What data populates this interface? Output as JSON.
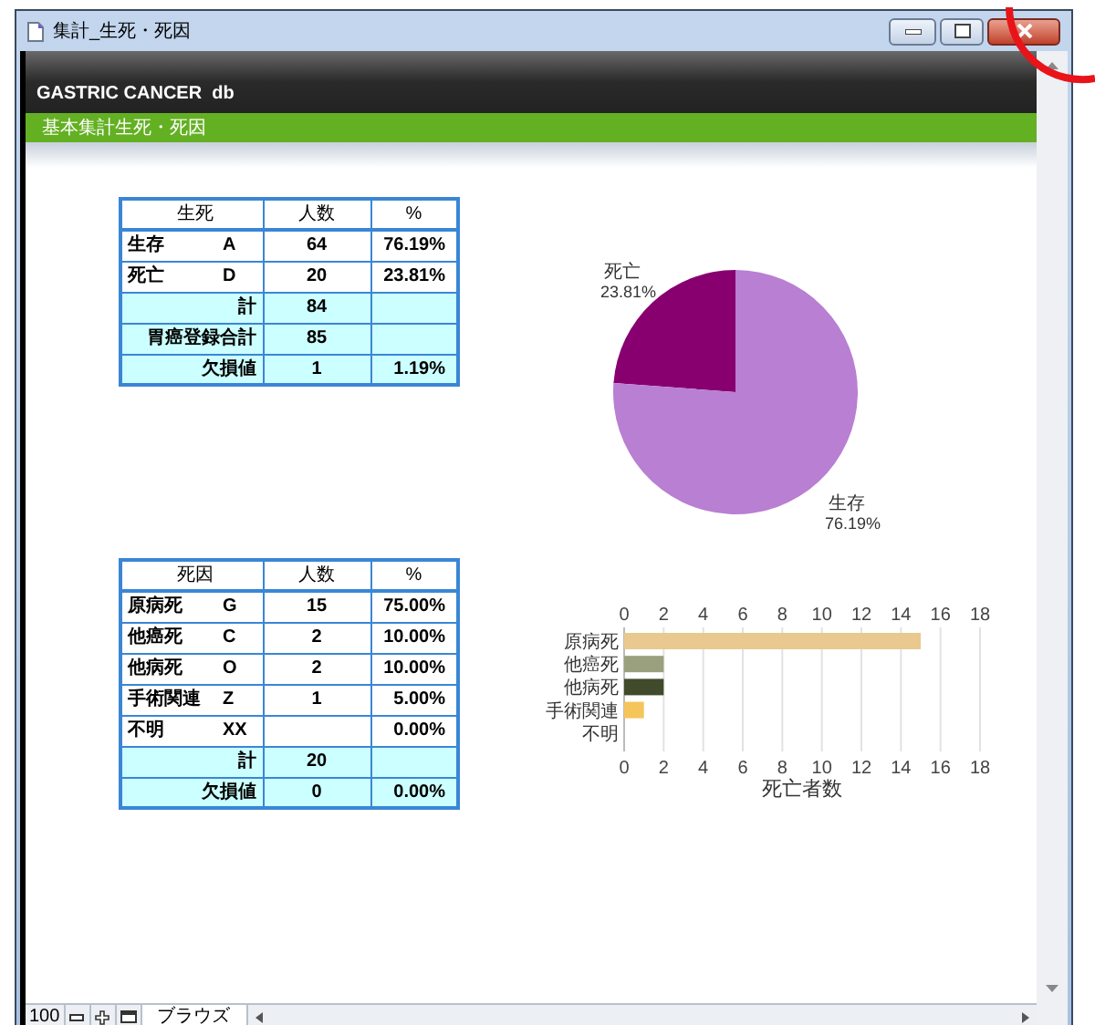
{
  "window": {
    "title": "集計_生死・死因"
  },
  "header": {
    "title": "GASTRIC CANCER  db",
    "subtitle": "基本集計生死・死因"
  },
  "survival_table": {
    "columns": [
      "生死",
      "人数",
      "%"
    ],
    "rows": [
      {
        "kind": "data",
        "label": "生存",
        "code": "A",
        "count": "64",
        "percent": "76.19%"
      },
      {
        "kind": "data",
        "label": "死亡",
        "code": "D",
        "count": "20",
        "percent": "23.81%"
      },
      {
        "kind": "total",
        "label": "計",
        "count": "84"
      },
      {
        "kind": "total",
        "label": "胃癌登録合計",
        "count": "85"
      },
      {
        "kind": "total",
        "label": "欠損値",
        "count": "1",
        "percent": "1.19%"
      }
    ]
  },
  "survival_chart": {
    "chart_data": {
      "type": "pie",
      "categories": [
        "死亡",
        "生存"
      ],
      "values": [
        23.81,
        76.19
      ],
      "colors": [
        "#880070",
        "#b87fd2"
      ],
      "value_labels": [
        "23.81%",
        "76.19%"
      ]
    }
  },
  "cause_table": {
    "columns": [
      "死因",
      "人数",
      "%"
    ],
    "rows": [
      {
        "kind": "data",
        "label": "原病死",
        "code": "G",
        "count": "15",
        "percent": "75.00%"
      },
      {
        "kind": "data",
        "label": "他癌死",
        "code": "C",
        "count": "2",
        "percent": "10.00%"
      },
      {
        "kind": "data",
        "label": "他病死",
        "code": "O",
        "count": "2",
        "percent": "10.00%"
      },
      {
        "kind": "data",
        "label": "手術関連",
        "code": "Z",
        "count": "1",
        "percent": "5.00%"
      },
      {
        "kind": "data",
        "label": "不明",
        "code": "XX",
        "percent": "0.00%"
      },
      {
        "kind": "total",
        "label": "計",
        "count": "20"
      },
      {
        "kind": "total",
        "label": "欠損値",
        "count": "0",
        "percent": "0.00%"
      }
    ]
  },
  "cause_chart": {
    "chart_data": {
      "type": "bar",
      "orientation": "horizontal",
      "grid": true,
      "xlabel": "死亡者数",
      "series": [
        {
          "name": "原病死",
          "color": "#e9c98f",
          "values": [
            15,
            null,
            null,
            null,
            null
          ]
        },
        {
          "name": "他癌死",
          "color": "#9a9f7e",
          "values": [
            null,
            2,
            null,
            null,
            null
          ]
        },
        {
          "name": "他病死",
          "color": "#414b2c",
          "values": [
            null,
            null,
            2,
            null,
            null
          ]
        },
        {
          "name": "手術関連",
          "color": "#f5c55a",
          "values": [
            null,
            null,
            null,
            1,
            null
          ]
        },
        {
          "name": "不明",
          "values": [
            null,
            null,
            null,
            null,
            0
          ]
        }
      ],
      "xlim": [
        0,
        18
      ],
      "xticks": [
        0,
        2,
        4,
        6,
        8,
        10,
        12,
        14,
        16,
        18
      ]
    },
    "bottom_axis_labels": [
      "0",
      "2",
      "4",
      "6",
      "8",
      "10",
      "12",
      "14",
      "16",
      "18"
    ]
  },
  "status_bar": {
    "zoom": "100",
    "mode": "ブラウズ"
  }
}
